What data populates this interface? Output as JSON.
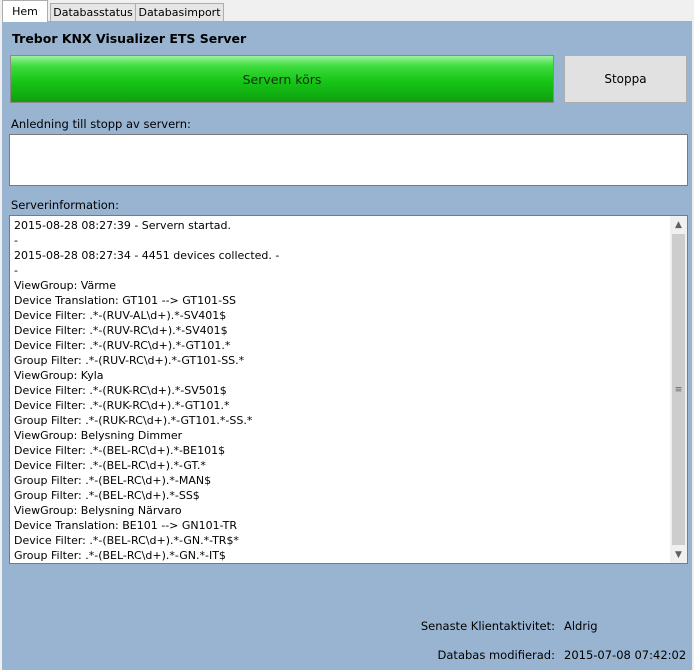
{
  "tabs": [
    {
      "label": "Hem",
      "active": true
    },
    {
      "label": "Databasstatus",
      "active": false
    },
    {
      "label": "Databasimport",
      "active": false
    }
  ],
  "app_title": "Trebor KNX Visualizer ETS Server",
  "status": {
    "label": "Servern körs",
    "color": "#17c517"
  },
  "stop_button": {
    "label": "Stoppa"
  },
  "stop_reason": {
    "label": "Anledning till stopp av servern:",
    "value": ""
  },
  "server_info": {
    "label": "Serverinformation:",
    "lines": [
      "2015-08-28 08:27:39 - Servern startad.",
      "-",
      "2015-08-28 08:27:34 - 4451 devices collected. -",
      "-",
      "ViewGroup: Värme",
      "Device Translation: GT101 --> GT101-SS",
      "Device Filter: .*-(RUV-AL\\d+).*-SV401$",
      "Device Filter: .*-(RUV-RC\\d+).*-SV401$",
      "Device Filter: .*-(RUV-RC\\d+).*-GT101.*",
      "Group Filter: .*-(RUV-RC\\d+).*-GT101-SS.*",
      "ViewGroup: Kyla",
      "Device Filter: .*-(RUK-RC\\d+).*-SV501$",
      "Device Filter: .*-(RUK-RC\\d+).*-GT101.*",
      "Group Filter: .*-(RUK-RC\\d+).*-GT101.*-SS.*",
      "ViewGroup: Belysning Dimmer",
      "Device Filter: .*-(BEL-RC\\d+).*-BE101$",
      "Device Filter: .*-(BEL-RC\\d+).*-GT.*",
      "Group Filter: .*-(BEL-RC\\d+).*-MAN$",
      "Group Filter: .*-(BEL-RC\\d+).*-SS$",
      "ViewGroup: Belysning Närvaro",
      "Device Translation: BE101 --> GN101-TR",
      "Device Filter: .*-(BEL-RC\\d+).*-GN.*-TR$*",
      "Group Filter: .*-(BEL-RC\\d+).*-GN.*-IT$"
    ]
  },
  "footer": {
    "last_client_activity_label": "Senaste Klientaktivitet:",
    "last_client_activity_value": "Aldrig",
    "db_modified_label": "Databas modifierad:",
    "db_modified_value": "2015-07-08 07:42:02"
  }
}
